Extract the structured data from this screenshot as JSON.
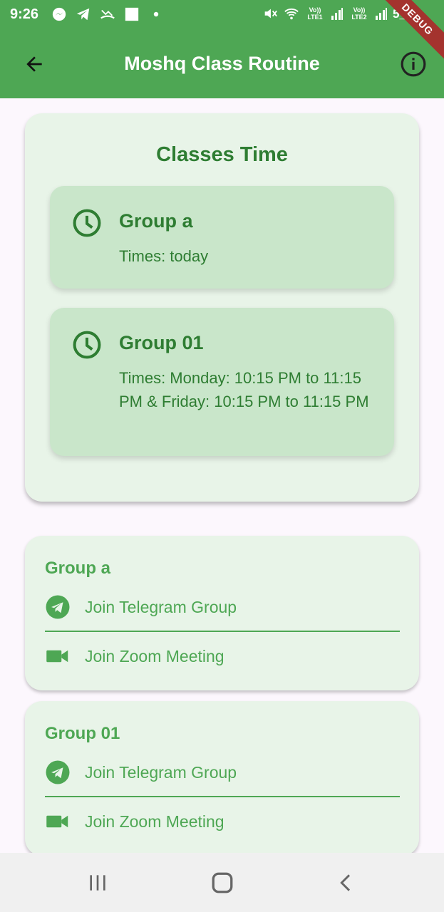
{
  "status_bar": {
    "time": "9:26",
    "battery": "5_%",
    "lte1": "Vo)) LTE1",
    "lte2": "Vo)) LTE2",
    "debug": "DEBUG"
  },
  "app_bar": {
    "title": "Moshq Class Routine",
    "color": "#4ea754"
  },
  "classes_card": {
    "title": "Classes Time",
    "items": [
      {
        "name": "Group a",
        "times": "Times: today"
      },
      {
        "name": "Group 01",
        "times": "Times: Monday: 10:15 PM to 11:15 PM & Friday: 10:15 PM to 11:15 PM"
      }
    ]
  },
  "group_cards": [
    {
      "name": "Group a",
      "telegram_label": "Join Telegram Group",
      "zoom_label": "Join Zoom Meeting"
    },
    {
      "name": "Group 01",
      "telegram_label": "Join Telegram Group",
      "zoom_label": "Join Zoom Meeting"
    }
  ],
  "icons": {
    "back": "arrow-back-icon",
    "info": "info-icon",
    "clock": "clock-icon",
    "telegram": "telegram-icon",
    "zoom": "video-camera-icon",
    "nav_recents": "recents-icon",
    "nav_home": "home-icon",
    "nav_back": "back-chevron-icon"
  }
}
